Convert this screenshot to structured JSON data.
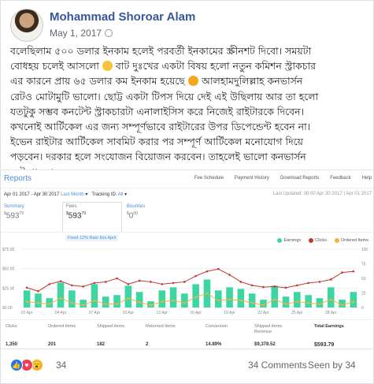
{
  "post": {
    "author": "Mohammad Shoroar Alam",
    "date": "May 1, 2017",
    "text_lines": [
      "বলেছিলাম ৫০০ ডলার ইনকাম হলেই পরবর্তী ইনকামের স্ক্রীনশট দিবো। সময়টা",
      "বোধহয় চলেই আসলো",
      " বাট দুঃখের একটা বিষয় হলো নতুন কমিশন স্ট্রাকচার",
      "এর কারনে প্রায় ৬৫ ডলার কম ইনকাম হয়েছে",
      " আলহামদুলিল্লাহ কনভার্সন",
      "রেটও মোটামুটি ভালো। ছোট্ট একটা টিপস দিয়ে দেই এই উছিলায় আর তা হলো",
      "যতটুকু সম্ভব কনটেন্ট স্ট্রাকচারটা এনালাইসিস করে নিজেই রাইটারকে দিবেন।",
      "কখনোই আর্টিকেল এর জন্য সম্পূর্ণভাবে রাইটারের উপর ডিপেন্ডেন্ট হবেন না।",
      "ইভেন রাইটার আর্টিকেল সাবমিট করার পর সম্পূর্ণ আর্টিকেল মনোযোগ দিয়ে",
      "পড়বেন। দরকার হলে সংযোজন বিয়োজন করবেন। তাহলেই ভালো কনভার্সন",
      "রেট পাওয়া সম্ভব।"
    ]
  },
  "screenshot": {
    "title": "Reports",
    "top_links": [
      "Fee Schedule",
      "Payment History",
      "Download Reports",
      "Feedback",
      "Help"
    ],
    "date_range": "Apr 01 2017 - Apr 30 2017",
    "last_month": "Last Month",
    "tracking_id_label": "Tracking ID:",
    "tracking_id_value": "All",
    "last_updated": "Last Updated: 00:00 Apr 30 2017 | Apr 01 2017",
    "tabs": [
      {
        "label": "Summary",
        "int": "593",
        "dec": "79"
      },
      {
        "label": "Fees",
        "int": "593",
        "dec": "79"
      },
      {
        "label": "Bounties",
        "int": "0",
        "dec": "00"
      }
    ],
    "fees_link": "Fixed 12% Rate this April",
    "legend": [
      {
        "label": "Earnings",
        "color": "#3dd6a3"
      },
      {
        "label": "Clicks",
        "color": "#c0392b"
      },
      {
        "label": "Ordered Items",
        "color": "#f5b041"
      }
    ],
    "stats": [
      {
        "label": "Clicks",
        "value": "1,350"
      },
      {
        "label": "Ordered Items",
        "value": "201"
      },
      {
        "label": "Shipped Items",
        "value": "182"
      },
      {
        "label": "Returned Items",
        "value": "2"
      },
      {
        "label": "Conversion",
        "value": "14.89%"
      },
      {
        "label": "Shipped Items Revenue",
        "value": "$9,378.52"
      },
      {
        "label": "Total Earnings",
        "value": "$593.79"
      }
    ]
  },
  "chart_data": {
    "type": "bar",
    "y_tick_labels": [
      "$75.00",
      "$50.00",
      "$25.00",
      "$0.00"
    ],
    "ylim": [
      0,
      75
    ],
    "right_tick_labels": [
      "100",
      "75",
      "50",
      "25",
      "0"
    ],
    "y2lim": [
      0,
      100
    ],
    "x_tick_labels": [
      "01 Apr",
      "04 Apr",
      "07 Apr",
      "10 Apr",
      "13 Apr",
      "16 Apr",
      "19 Apr",
      "22 Apr",
      "25 Apr",
      "28 Apr"
    ],
    "series": [
      {
        "name": "Earnings",
        "values": [
          22,
          18,
          12,
          32,
          22,
          10,
          30,
          14,
          16,
          28,
          20,
          8,
          22,
          26,
          18,
          30,
          36,
          22,
          26,
          24,
          18,
          10,
          28,
          14,
          20,
          16,
          12,
          26,
          10,
          20
        ]
      },
      {
        "name": "Clicks",
        "values": [
          34,
          28,
          40,
          45,
          38,
          36,
          42,
          44,
          50,
          40,
          46,
          44,
          40,
          42,
          44,
          54,
          62,
          66,
          56,
          44,
          38,
          35,
          36,
          34,
          38,
          42,
          44,
          48,
          60,
          62
        ]
      },
      {
        "name": "Ordered Items",
        "values": [
          10,
          8,
          6,
          16,
          8,
          4,
          12,
          6,
          6,
          16,
          9,
          4,
          10,
          12,
          8,
          18,
          24,
          12,
          14,
          12,
          8,
          4,
          14,
          6,
          10,
          8,
          6,
          14,
          4,
          10
        ]
      }
    ]
  },
  "reactions": {
    "count": "34",
    "comments": "34 Comments",
    "seen": "Seen by 34",
    "colors": {
      "like": "#1877f2",
      "love": "#f33e58",
      "wow": "#f7b125"
    }
  }
}
